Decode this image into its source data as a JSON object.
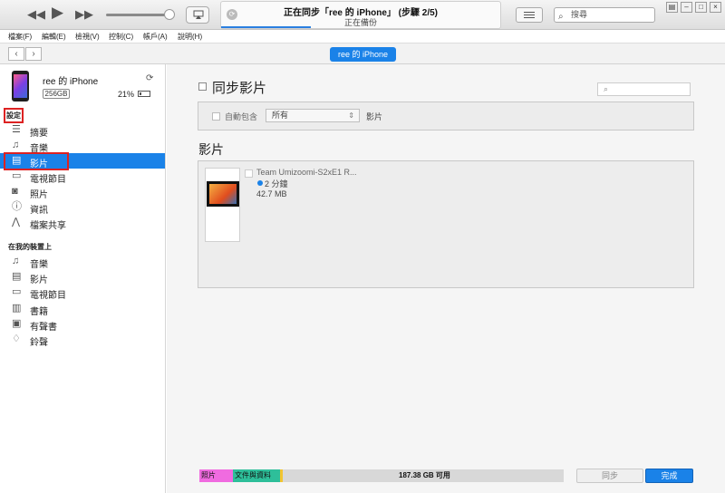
{
  "toolbar": {
    "rewind_icon": "rewind-icon",
    "play_icon": "play-icon",
    "forward_icon": "fast-forward-icon",
    "status_title": "正在同步「ree 的 iPhone」 (步驟 2/5)",
    "status_subtitle": "正在備份",
    "sync_progress": 0.32,
    "search_placeholder": "搜尋"
  },
  "menu": [
    "檔案(F)",
    "編輯(E)",
    "檢視(V)",
    "控制(C)",
    "帳戶(A)",
    "說明(H)"
  ],
  "device_pill": "ree 的 iPhone",
  "device": {
    "name": "ree 的 iPhone",
    "capacity": "256GB",
    "battery": "21%",
    "battery_level": 0.21
  },
  "sidebar": {
    "settings_header": "設定",
    "settings_items": [
      {
        "label": "摘要",
        "icon": "summary-icon"
      },
      {
        "label": "音樂",
        "icon": "music-note-icon"
      },
      {
        "label": "影片",
        "icon": "film-icon",
        "selected": true
      },
      {
        "label": "電視節目",
        "icon": "tv-icon"
      },
      {
        "label": "照片",
        "icon": "camera-icon"
      },
      {
        "label": "資訊",
        "icon": "info-icon"
      },
      {
        "label": "檔案共享",
        "icon": "file-sharing-icon"
      }
    ],
    "ondevice_header": "在我的裝置上",
    "ondevice_items": [
      {
        "label": "音樂",
        "icon": "music-note-icon"
      },
      {
        "label": "影片",
        "icon": "film-icon"
      },
      {
        "label": "電視節目",
        "icon": "tv-icon"
      },
      {
        "label": "書籍",
        "icon": "book-icon"
      },
      {
        "label": "有聲書",
        "icon": "audiobook-icon"
      },
      {
        "label": "鈴聲",
        "icon": "bell-icon"
      }
    ]
  },
  "main": {
    "sync_title": "同步影片",
    "auto_include_label": "自動包含",
    "auto_include_value": "所有",
    "auto_include_suffix": "影片",
    "movies_header": "影片",
    "movie": {
      "title": "Team Umizoomi-S2xE1 R...",
      "duration": "2 分鐘",
      "size": "42.7 MB"
    }
  },
  "storage": {
    "photos_label": "照片",
    "docs_label": "文件與資料",
    "free_label": "187.38 GB 可用",
    "colors": {
      "photos": "#f06be0",
      "docs": "#2ebf9a",
      "other": "#f2c531",
      "free": "#d8d8d8"
    }
  },
  "buttons": {
    "sync": "同步",
    "done": "完成"
  }
}
